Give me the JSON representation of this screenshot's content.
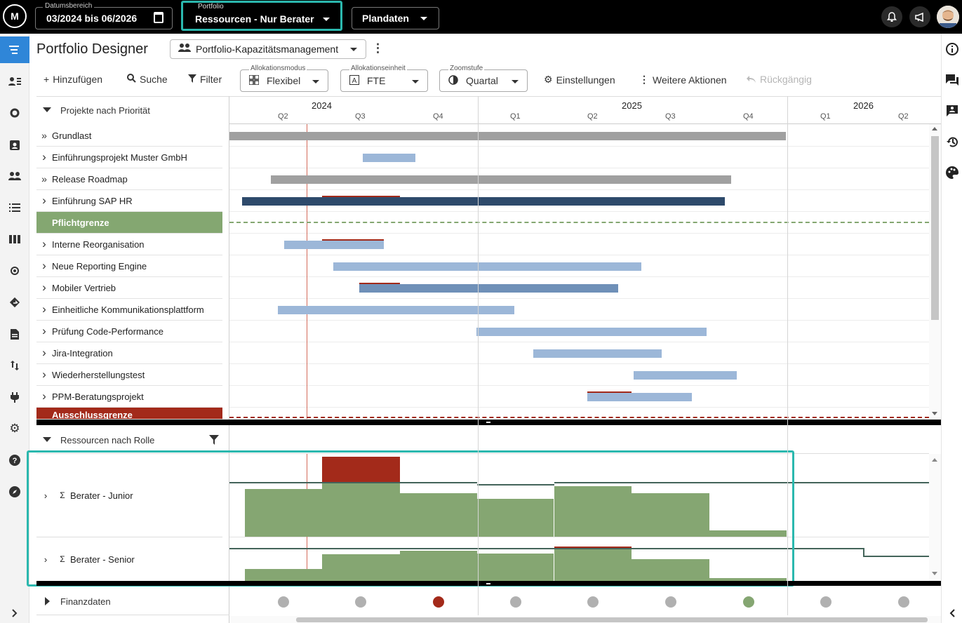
{
  "topbar": {
    "logo_text": "M",
    "date_range": {
      "legend": "Datumsbereich",
      "value": "03/2024 bis 06/2026",
      "icon": "calendar-icon"
    },
    "portfolio": {
      "legend": "Portfolio",
      "value": "Ressourcen - Nur Berater"
    },
    "data_mode": {
      "value": "Plandaten"
    },
    "icons": [
      "bell-icon",
      "megaphone-icon",
      "user-avatar"
    ],
    "highlight_color": "#2bb8ae"
  },
  "leftnav": {
    "items": [
      "gantt-icon",
      "user-list-icon",
      "refresh-icon",
      "badge-icon",
      "people-icon",
      "list-icon",
      "columns-icon",
      "target-icon",
      "route-icon",
      "document-icon",
      "swap-icon",
      "plug-icon",
      "gear-icon",
      "help-icon",
      "compass-icon",
      "chevron-right-icon"
    ],
    "active_index": 0,
    "active_color": "#2f86d8"
  },
  "rightnav": {
    "items": [
      "info-icon",
      "chat-icon",
      "contact-icon",
      "history-icon",
      "palette-icon",
      "chevron-left-icon"
    ]
  },
  "header": {
    "title": "Portfolio Designer",
    "view_selector": "Portfolio-Kapazitätsmanagement"
  },
  "toolbar": {
    "add": "Hinzufügen",
    "search": "Suche",
    "filter": "Filter",
    "allocation_mode": {
      "legend": "Allokationsmodus",
      "value": "Flexibel"
    },
    "allocation_unit": {
      "legend": "Allokationseinheit",
      "value": "FTE"
    },
    "zoom": {
      "legend": "Zoomstufe",
      "value": "Quartal"
    },
    "settings": "Einstellungen",
    "more_actions": "Weitere Aktionen",
    "undo": "Rückgängig"
  },
  "timeline": {
    "years": [
      "2024",
      "2025",
      "2026"
    ],
    "quarters": [
      "Q2",
      "Q3",
      "Q4",
      "Q1",
      "Q2",
      "Q3",
      "Q4",
      "Q1",
      "Q2"
    ]
  },
  "projects": {
    "header": "Projekte nach Priorität",
    "rows": [
      {
        "label": "Grundlast",
        "icon": "double-chevron-icon",
        "kind": "normal"
      },
      {
        "label": "Einführungsprojekt Muster GmbH",
        "icon": "chevron-right-icon",
        "kind": "normal"
      },
      {
        "label": "Release Roadmap",
        "icon": "double-chevron-icon",
        "kind": "normal"
      },
      {
        "label": "Einführung SAP HR",
        "icon": "chevron-right-icon",
        "kind": "normal"
      },
      {
        "label": "Pflichtgrenze",
        "icon": "",
        "kind": "mandatory-limit"
      },
      {
        "label": "Interne Reorganisation",
        "icon": "chevron-right-icon",
        "kind": "normal"
      },
      {
        "label": "Neue Reporting Engine",
        "icon": "chevron-right-icon",
        "kind": "normal"
      },
      {
        "label": "Mobiler Vertrieb",
        "icon": "chevron-right-icon",
        "kind": "normal"
      },
      {
        "label": "Einheitliche Kommunikationsplattform",
        "icon": "chevron-right-icon",
        "kind": "normal"
      },
      {
        "label": "Prüfung Code-Performance",
        "icon": "chevron-right-icon",
        "kind": "normal"
      },
      {
        "label": "Jira-Integration",
        "icon": "chevron-right-icon",
        "kind": "normal"
      },
      {
        "label": "Wiederherstellungstest",
        "icon": "chevron-right-icon",
        "kind": "normal"
      },
      {
        "label": "PPM-Beratungsprojekt",
        "icon": "chevron-right-icon",
        "kind": "normal"
      },
      {
        "label": "Ausschlussgrenze",
        "icon": "",
        "kind": "exclusion-limit"
      }
    ]
  },
  "resources": {
    "header": "Ressourcen nach Rolle",
    "rows": [
      {
        "label": "Berater - Junior"
      },
      {
        "label": "Berater - Senior"
      }
    ]
  },
  "finance": {
    "header": "Finanzdaten",
    "status_colors": [
      "#b0b0b0",
      "#b0b0b0",
      "#a32a1a",
      "#b0b0b0",
      "#b0b0b0",
      "#b0b0b0",
      "#85a672",
      "#b0b0b0",
      "#b0b0b0"
    ]
  },
  "colors": {
    "mandatory_limit": "#84a771",
    "exclusion_limit": "#a32a1a",
    "bar_light": "#9cb7d8",
    "bar_dark": "#2e4a6b",
    "bar_mid": "#6f90b8",
    "bar_gray": "#a0a0a0",
    "capacity_ok": "#85a672",
    "capacity_over": "#a32a1a"
  }
}
